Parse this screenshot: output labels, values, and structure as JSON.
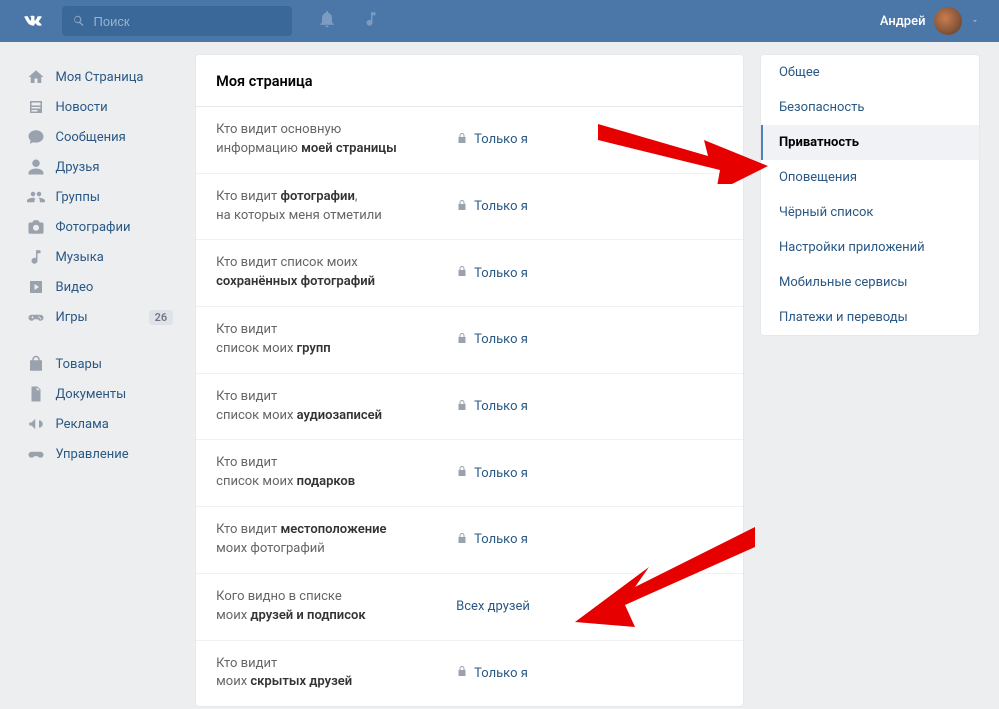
{
  "header": {
    "search_placeholder": "Поиск",
    "username": "Андрей"
  },
  "leftnav": {
    "items": [
      {
        "label": "Моя Страница"
      },
      {
        "label": "Новости"
      },
      {
        "label": "Сообщения"
      },
      {
        "label": "Друзья"
      },
      {
        "label": "Группы"
      },
      {
        "label": "Фотографии"
      },
      {
        "label": "Музыка"
      },
      {
        "label": "Видео"
      },
      {
        "label": "Игры",
        "badge": "26"
      }
    ],
    "items2": [
      {
        "label": "Товары"
      },
      {
        "label": "Документы"
      },
      {
        "label": "Реклама"
      },
      {
        "label": "Управление"
      }
    ]
  },
  "settings": {
    "title": "Моя страница",
    "rows": [
      {
        "pre": "Кто видит основную",
        "post_pre": "информацию ",
        "bold": "моей страницы",
        "value": "Только я",
        "lock": true
      },
      {
        "pre": "Кто видит ",
        "bold": "фотографии",
        "post": ",",
        "line2": "на которых меня отметили",
        "value": "Только я",
        "lock": true
      },
      {
        "pre": "Кто видит список моих",
        "bold2": "сохранённых фотографий",
        "value": "Только я",
        "lock": true
      },
      {
        "pre": "Кто видит",
        "line2pre": "список моих ",
        "bold": "групп",
        "value": "Только я",
        "lock": true
      },
      {
        "pre": "Кто видит",
        "line2pre": "список моих ",
        "bold": "аудиозаписей",
        "value": "Только я",
        "lock": true
      },
      {
        "pre": "Кто видит",
        "line2pre": "список моих ",
        "bold": "подарков",
        "value": "Только я",
        "lock": true
      },
      {
        "pre": "Кто видит ",
        "bold": "местоположение",
        "line2": "моих фотографий",
        "value": "Только я",
        "lock": true
      },
      {
        "pre": "Кого видно в списке",
        "line2pre": "моих ",
        "bold": "друзей и подписок",
        "value": "Всех друзей",
        "lock": false
      },
      {
        "pre": "Кто видит",
        "line2pre": "моих ",
        "bold": "скрытых друзей",
        "value": "Только я",
        "lock": true
      }
    ]
  },
  "rightnav": {
    "items": [
      {
        "label": "Общее"
      },
      {
        "label": "Безопасность"
      },
      {
        "label": "Приватность",
        "active": true
      },
      {
        "label": "Оповещения"
      },
      {
        "label": "Чёрный список"
      },
      {
        "label": "Настройки приложений"
      },
      {
        "label": "Мобильные сервисы"
      },
      {
        "label": "Платежи и переводы"
      }
    ]
  }
}
